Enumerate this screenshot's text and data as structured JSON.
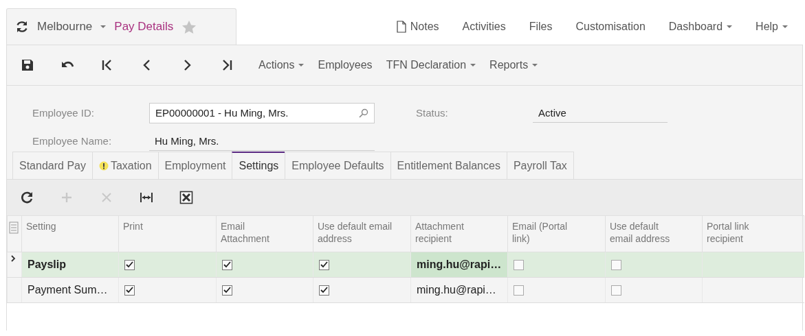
{
  "header": {
    "breadcrumb": {
      "branch": "Melbourne",
      "screen": "Pay Details",
      "favorite": false
    },
    "links": [
      {
        "label": "Notes",
        "kind": "notes"
      },
      {
        "label": "Activities",
        "kind": "plain"
      },
      {
        "label": "Files",
        "kind": "plain"
      },
      {
        "label": "Customisation",
        "kind": "plain"
      },
      {
        "label": "Dashboard",
        "kind": "menu"
      },
      {
        "label": "Help",
        "kind": "menu"
      }
    ]
  },
  "toolbar": [
    {
      "kind": "save"
    },
    {
      "kind": "undo"
    },
    {
      "kind": "first"
    },
    {
      "kind": "prev"
    },
    {
      "kind": "next"
    },
    {
      "kind": "last"
    },
    {
      "kind": "menu",
      "label": "Actions"
    },
    {
      "kind": "text",
      "label": "Employees"
    },
    {
      "kind": "menu",
      "label": "TFN Declaration"
    },
    {
      "kind": "menu",
      "label": "Reports"
    }
  ],
  "form": {
    "employee_id": {
      "label": "Employee ID:",
      "value": "EP00000001 - Hu Ming, Mrs."
    },
    "employee_name": {
      "label": "Employee Name:",
      "value": "Hu Ming, Mrs."
    },
    "status": {
      "label": "Status:",
      "value": "Active"
    }
  },
  "tabs": [
    {
      "label": "Standard Pay",
      "selected": false,
      "warning": false
    },
    {
      "label": "Taxation",
      "selected": false,
      "warning": true
    },
    {
      "label": "Employment",
      "selected": false,
      "warning": false
    },
    {
      "label": "Settings",
      "selected": true,
      "warning": false
    },
    {
      "label": "Employee Defaults",
      "selected": false,
      "warning": false
    },
    {
      "label": "Entitlement Balances",
      "selected": false,
      "warning": false
    },
    {
      "label": "Payroll Tax",
      "selected": false,
      "warning": false
    }
  ],
  "grid_toolbar": [
    {
      "kind": "refresh",
      "disabled": false
    },
    {
      "kind": "add",
      "disabled": true
    },
    {
      "kind": "delete",
      "disabled": true
    },
    {
      "kind": "fit",
      "disabled": false
    },
    {
      "kind": "excel",
      "disabled": false
    }
  ],
  "table": {
    "columns": [
      "Setting",
      "Print",
      "Email Attachment",
      "Use default email address",
      "Attachment recipient",
      "Email (Portal link)",
      "Use default email address",
      "Portal link recipient"
    ],
    "rows": [
      {
        "selected": true,
        "setting": "Payslip",
        "print": true,
        "email_attachment": true,
        "use_default_email": true,
        "attachment_recipient": "ming.hu@rapi…",
        "recipient_focused": true,
        "email_portal": false,
        "use_default_email_portal": false
      },
      {
        "selected": false,
        "setting": "Payment Sum…",
        "print": true,
        "email_attachment": true,
        "use_default_email": true,
        "attachment_recipient": "ming.hu@rapi…",
        "recipient_focused": false,
        "email_portal": false,
        "use_default_email_portal": false
      }
    ]
  }
}
